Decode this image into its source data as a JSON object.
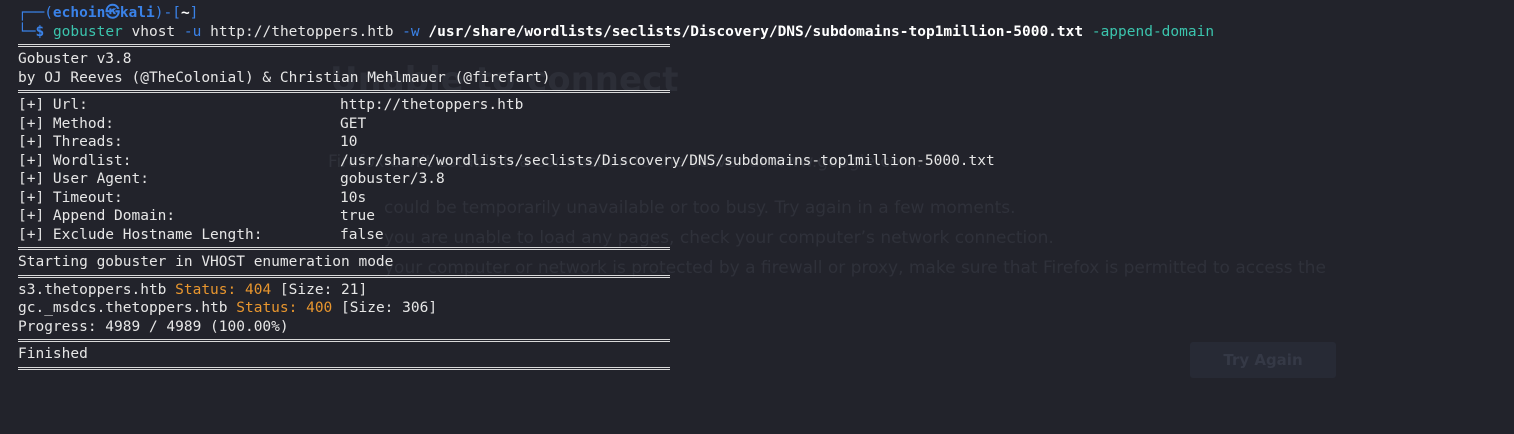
{
  "prompt": {
    "user": "echoin",
    "skull": "㉿",
    "host": "kali",
    "dir": "~",
    "symbol": "$"
  },
  "command": {
    "program": "gobuster",
    "mode": "vhost",
    "flag_u": "-u",
    "url": "http://thetoppers.htb",
    "flag_w": "-w",
    "wordlist": "/usr/share/wordlists/seclists/Discovery/DNS/subdomains-top1million-5000.txt",
    "flag_append": "-append-domain"
  },
  "banner": {
    "version": "Gobuster v3.8",
    "authors": "by OJ Reeves (@TheColonial) & Christian Mehlmauer (@firefart)"
  },
  "options": [
    {
      "label": "[+] Url:",
      "value": "http://thetoppers.htb"
    },
    {
      "label": "[+] Method:",
      "value": "GET"
    },
    {
      "label": "[+] Threads:",
      "value": "10"
    },
    {
      "label": "[+] Wordlist:",
      "value": "/usr/share/wordlists/seclists/Discovery/DNS/subdomains-top1million-5000.txt"
    },
    {
      "label": "[+] User Agent:",
      "value": "gobuster/3.8"
    },
    {
      "label": "[+] Timeout:",
      "value": "10s"
    },
    {
      "label": "[+] Append Domain:",
      "value": "true"
    },
    {
      "label": "[+] Exclude Hostname Length:",
      "value": "false"
    }
  ],
  "start_message": "Starting gobuster in VHOST enumeration mode",
  "results": [
    {
      "host": "s3.thetoppers.htb",
      "status_label": "Status:",
      "status": "404",
      "size": "[Size: 21]"
    },
    {
      "host": "gc._msdcs.thetoppers.htb",
      "status_label": "Status:",
      "status": "400",
      "size": "[Size: 306]"
    }
  ],
  "progress": "Progress: 4989 / 4989 (100.00%)",
  "finished": "Finished",
  "background_page": {
    "title": "Unable to connect",
    "line1": "Firefox can’t establish a connection to the server at www.google.com.",
    "line2": "could be temporarily unavailable or too busy. Try again in a few moments.",
    "line3": "you are unable to load any pages, check your computer’s network connection.",
    "line4": "your computer or network is protected by a firewall or proxy, make sure that Firefox is permitted to access the",
    "button": "Try Again"
  },
  "colors": {
    "background": "#22232b",
    "prompt_blue": "#3a82e8",
    "command_teal": "#3bc4ad",
    "status_orange": "#e8962e"
  }
}
